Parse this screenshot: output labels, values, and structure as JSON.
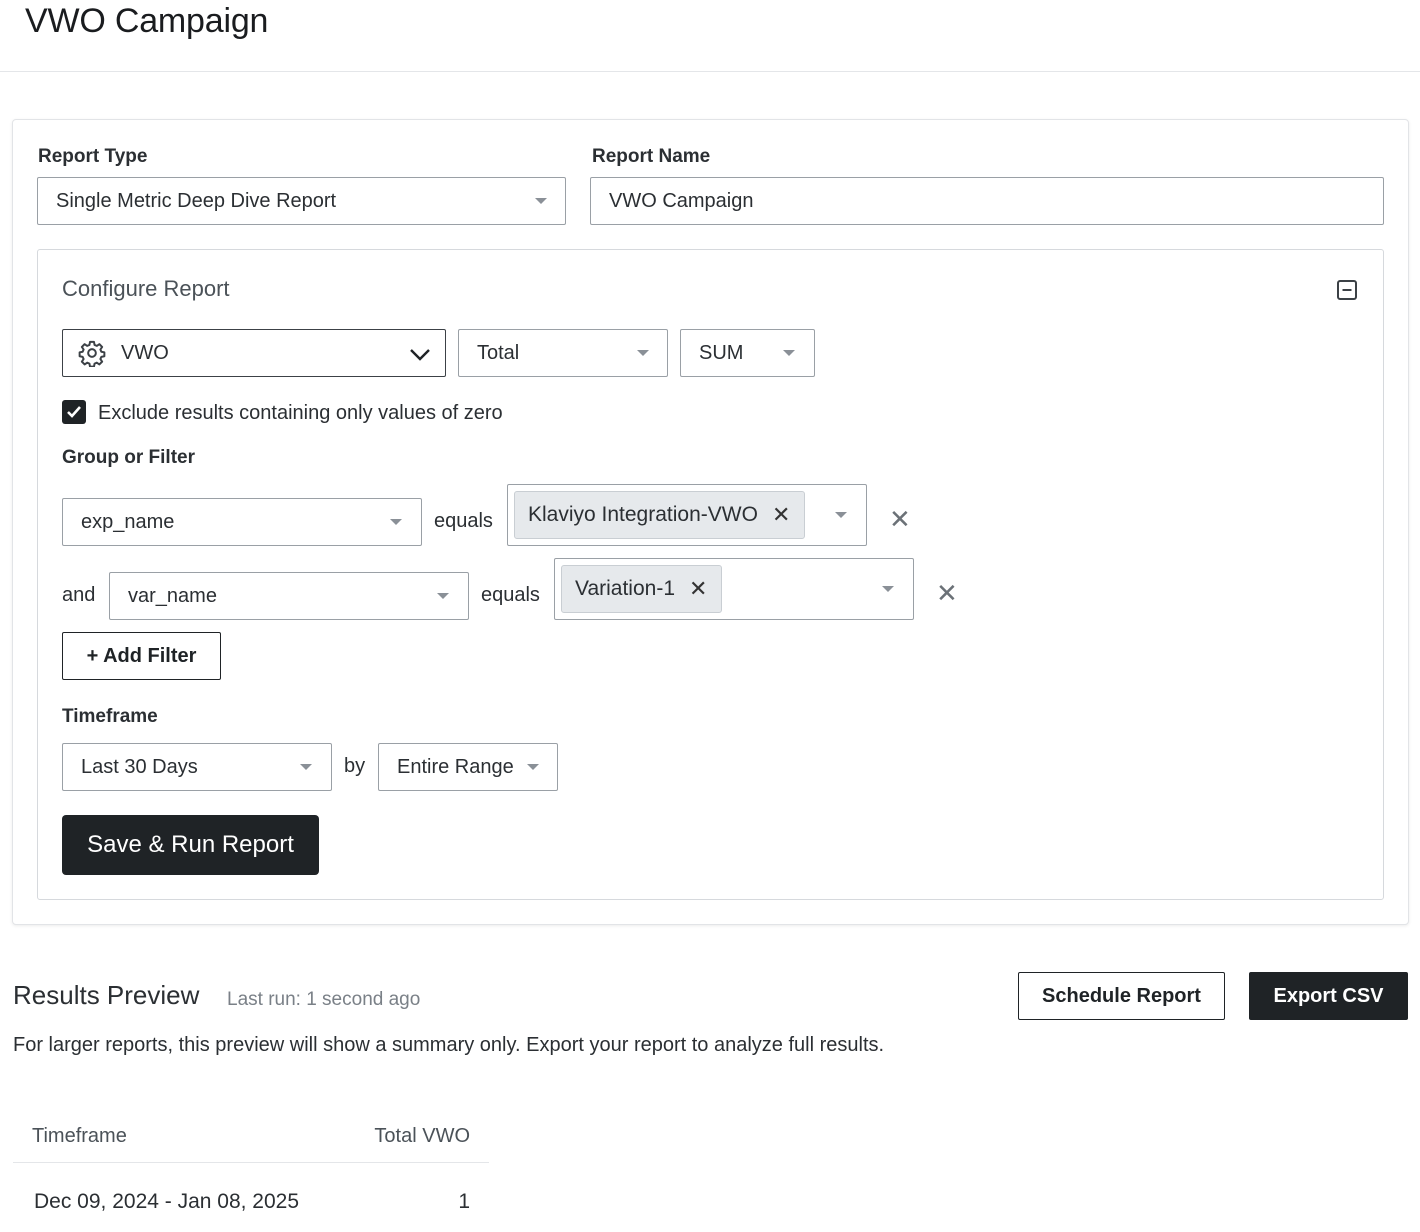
{
  "page": {
    "title": "VWO Campaign"
  },
  "report_form": {
    "report_type_label": "Report Type",
    "report_type_value": "Single Metric Deep Dive Report",
    "report_name_label": "Report Name",
    "report_name_value": "VWO Campaign"
  },
  "configure": {
    "title": "Configure Report",
    "metric": "VWO",
    "measure": "Total",
    "aggregation": "SUM",
    "exclude_zero_label": "Exclude results containing only values of zero",
    "exclude_zero_checked": true,
    "group_filter_label": "Group or Filter",
    "filters": [
      {
        "prefix": "",
        "field": "exp_name",
        "operator": "equals",
        "values": [
          "Klaviyo Integration-VWO"
        ]
      },
      {
        "prefix": "and",
        "field": "var_name",
        "operator": "equals",
        "values": [
          "Variation-1"
        ]
      }
    ],
    "add_filter_label": "+ Add Filter",
    "timeframe_label": "Timeframe",
    "timeframe_value": "Last 30 Days",
    "by_label": "by",
    "granularity_value": "Entire Range",
    "run_button_label": "Save & Run Report"
  },
  "results": {
    "title": "Results Preview",
    "last_run": "Last run: 1 second ago",
    "schedule_button": "Schedule Report",
    "export_button": "Export CSV",
    "note": "For larger reports, this preview will show a summary only. Export your report to analyze full results.",
    "columns": [
      "Timeframe",
      "Total VWO"
    ],
    "rows": [
      [
        "Dec 09, 2024 - Jan 08, 2025",
        "1"
      ]
    ]
  },
  "icons": {
    "metric_icon": "gear-icon",
    "collapse_icon": "collapse-minus-icon",
    "chip_remove": "close-icon",
    "filter_remove": "close-icon"
  }
}
